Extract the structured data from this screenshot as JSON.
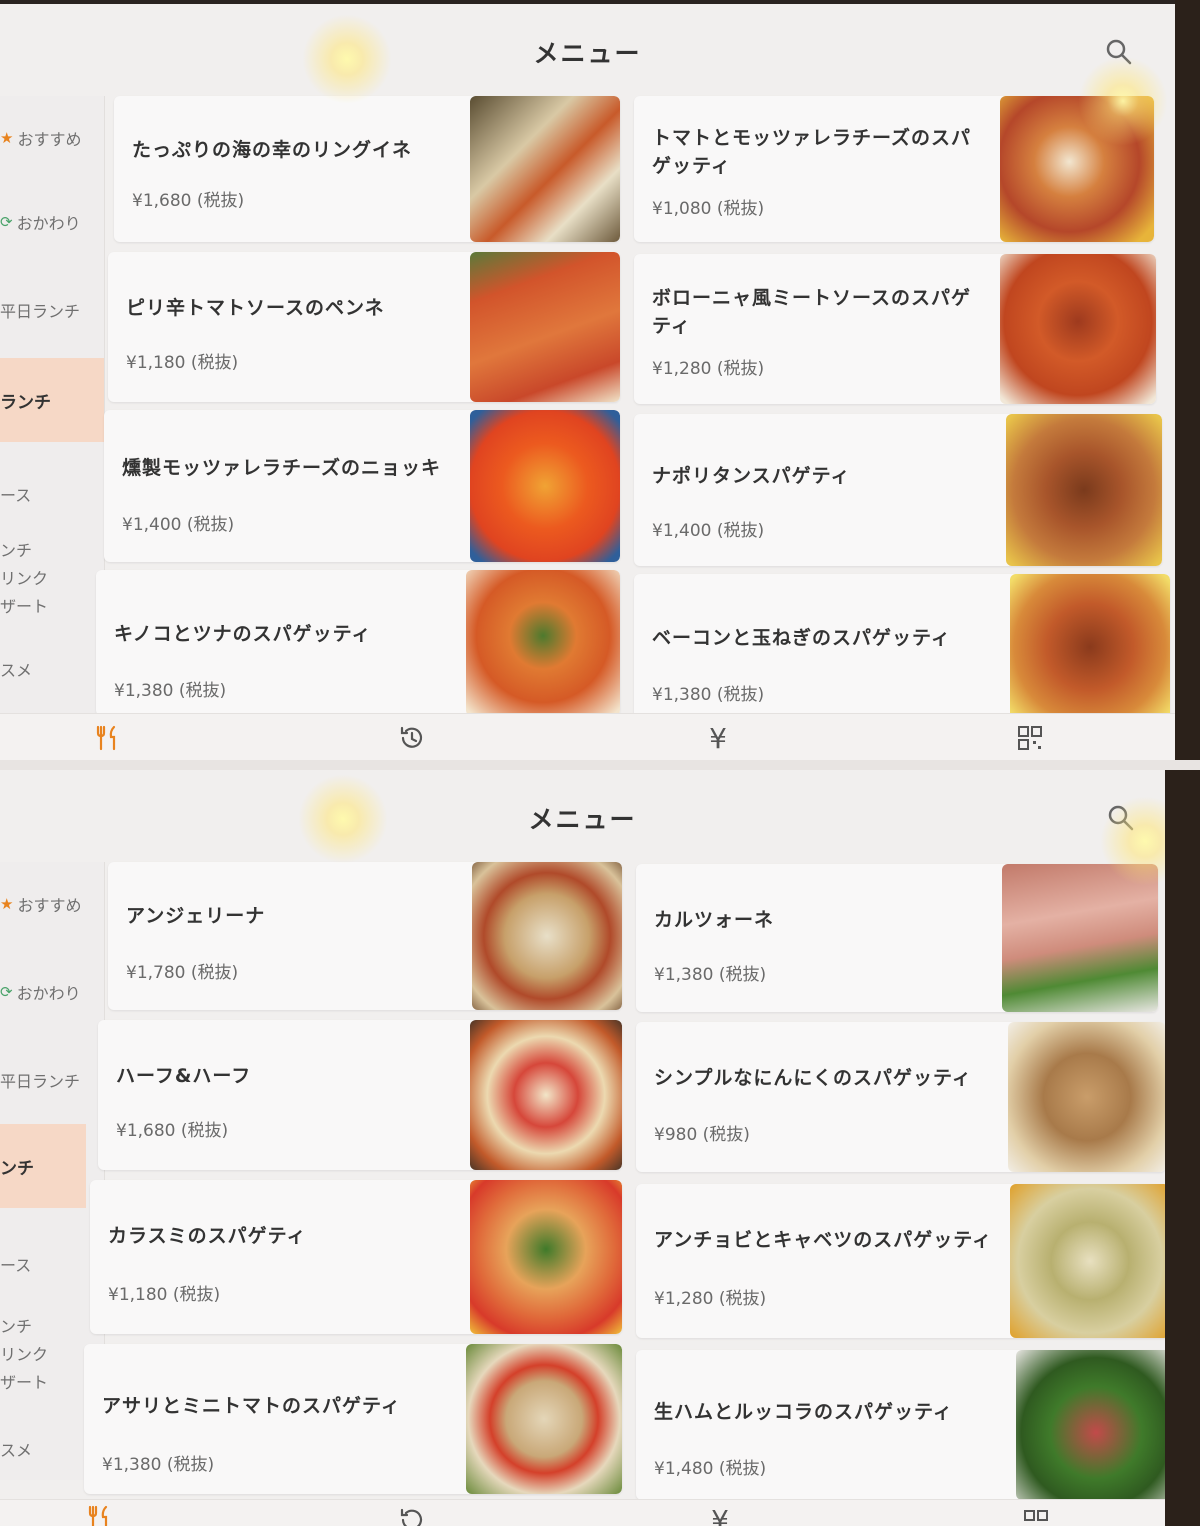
{
  "header": {
    "title": "メニュー"
  },
  "sidebar": {
    "items": [
      {
        "label": "おすすめ",
        "icon": "star-icon"
      },
      {
        "label": "おかわり",
        "icon": "refill-icon"
      },
      {
        "label": "平日ランチ"
      },
      {
        "label": "ランチ"
      },
      {
        "label": "ース"
      },
      {
        "label": "ンチ"
      },
      {
        "label": "リンク"
      },
      {
        "label": "ザート"
      },
      {
        "label": "スメ"
      }
    ],
    "bottom_items": [
      {
        "label": "おすすめ",
        "icon": "star-icon"
      },
      {
        "label": "おかわり",
        "icon": "refill-icon"
      },
      {
        "label": "平日ランチ"
      },
      {
        "label": "ンチ"
      },
      {
        "label": "ース"
      },
      {
        "label": "ンチ"
      },
      {
        "label": "リンク"
      },
      {
        "label": "ザート"
      },
      {
        "label": "スメ"
      }
    ]
  },
  "screen_top": {
    "items": [
      {
        "name": "たっぷりの海の幸のリングイネ",
        "price": "¥1,680 (税抜)",
        "image": "seafood-linguine-photo"
      },
      {
        "name": "トマトとモッツァレラチーズのスパゲッティ",
        "name_line1": "トマトとモッツァレラチーズのスパ",
        "name_line2": "ゲッティ",
        "price": "¥1,080 (税抜)",
        "image": "tomato-mozzarella-spaghetti-photo"
      },
      {
        "name": "ピリ辛トマトソースのペンネ",
        "price": "¥1,180 (税抜)",
        "image": "spicy-penne-photo"
      },
      {
        "name": "ボローニャ風ミートソースのスパゲッティ",
        "name_line1": "ボローニャ風ミートソースのスパゲ",
        "name_line2": "ティ",
        "price": "¥1,280 (税抜)",
        "image": "bolognese-photo"
      },
      {
        "name": "燻製モッツァレラチーズのニョッキ",
        "price": "¥1,400 (税抜)",
        "image": "gnocchi-photo"
      },
      {
        "name": "ナポリタンスパゲティ",
        "price": "¥1,400 (税抜)",
        "image": "napolitan-photo"
      },
      {
        "name": "キノコとツナのスパゲッティ",
        "price": "¥1,380 (税抜)",
        "image": "mushroom-tuna-photo"
      },
      {
        "name": "ベーコンと玉ねぎのスパゲッティ",
        "price": "¥1,380 (税抜)",
        "image": "bacon-onion-photo"
      }
    ]
  },
  "screen_bottom": {
    "items": [
      {
        "name": "アンジェリーナ",
        "price": "¥1,780 (税抜)",
        "image": "angelina-pizza-photo"
      },
      {
        "name": "カルツォーネ",
        "price": "¥1,380 (税抜)",
        "image": "calzone-photo"
      },
      {
        "name": "ハーフ&ハーフ",
        "price": "¥1,680 (税抜)",
        "image": "half-half-pizza-photo"
      },
      {
        "name": "シンプルなにんにくのスパゲッティ",
        "price": "¥980 (税抜)",
        "image": "garlic-spaghetti-photo"
      },
      {
        "name": "カラスミのスパゲティ",
        "price": "¥1,180 (税抜)",
        "image": "karasumi-photo"
      },
      {
        "name": "アンチョビとキャベツのスパゲッティ",
        "price": "¥1,280 (税抜)",
        "image": "anchovy-cabbage-photo"
      },
      {
        "name": "アサリとミニトマトのスパゲティ",
        "price": "¥1,380 (税抜)",
        "image": "clam-tomato-photo"
      },
      {
        "name": "生ハムとルッコラのスパゲッティ",
        "price": "¥1,480 (税抜)",
        "image": "ham-arugula-photo"
      }
    ]
  },
  "tabbar": {
    "tabs": [
      {
        "icon": "fork-knife-icon"
      },
      {
        "icon": "history-icon"
      },
      {
        "icon": "yen-icon",
        "glyph": "¥"
      },
      {
        "icon": "qr-code-icon"
      }
    ]
  },
  "colors": {
    "accent": "#e8831e",
    "active_bg": "#f6d8c6",
    "refill": "#4aa36a"
  }
}
